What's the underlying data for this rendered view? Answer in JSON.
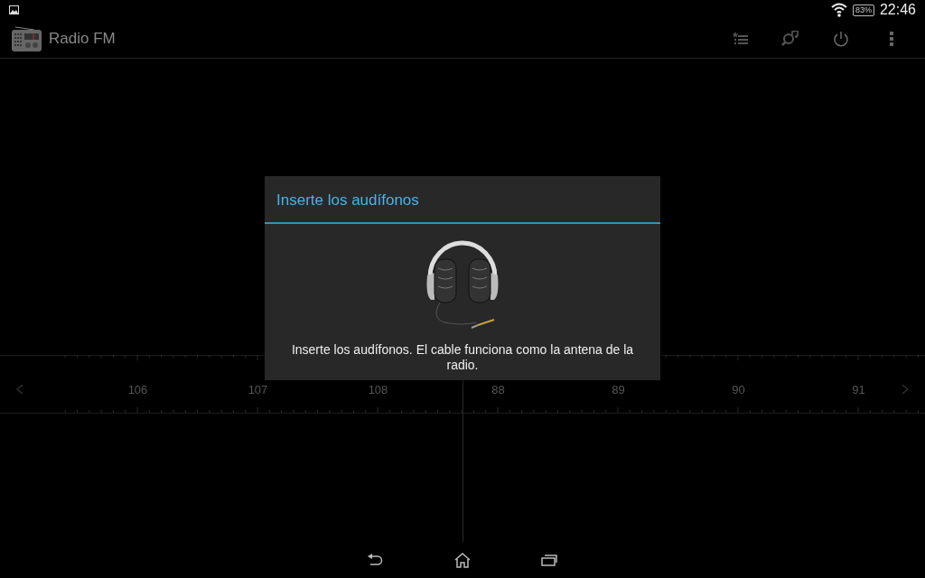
{
  "status_bar": {
    "battery": "83%",
    "time": "22:46"
  },
  "action_bar": {
    "title": "Radio FM"
  },
  "dial": {
    "labels": [
      "106",
      "107",
      "108",
      "88",
      "89",
      "90",
      "91"
    ]
  },
  "dialog": {
    "title": "Inserte los audífonos",
    "message": "Inserte los audífonos. El cable funciona como la antena de la radio."
  }
}
